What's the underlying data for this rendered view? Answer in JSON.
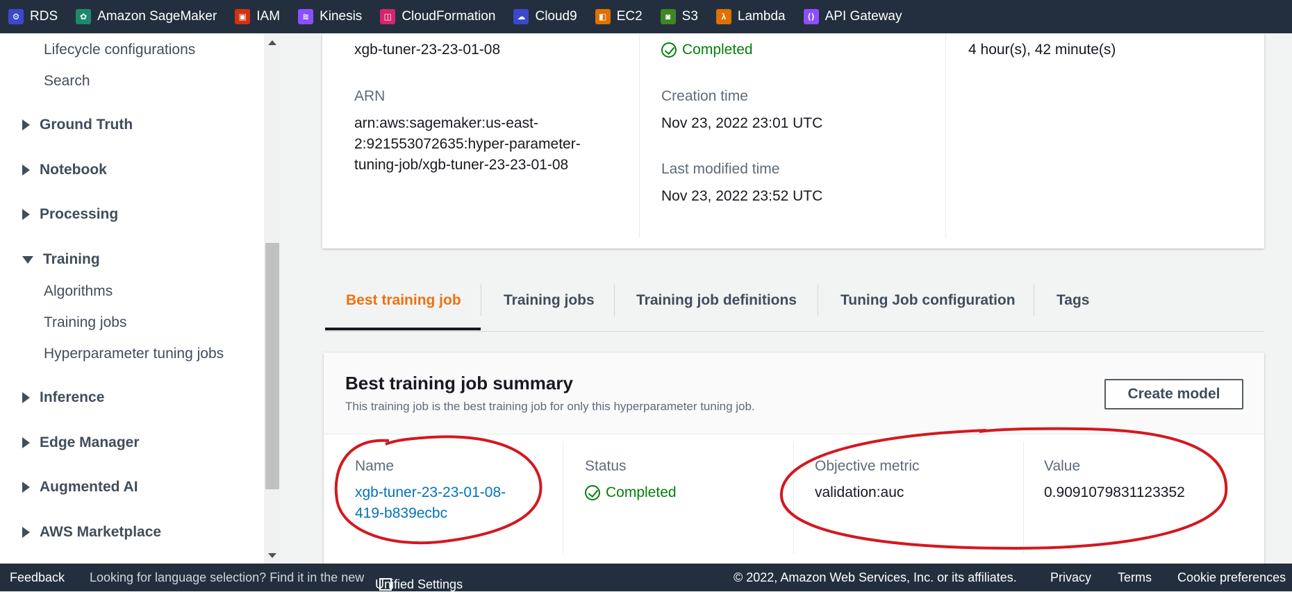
{
  "favorites": [
    {
      "label": "RDS",
      "icon": "rds-icon",
      "color": "#3b48cc"
    },
    {
      "label": "Amazon SageMaker",
      "icon": "sagemaker-icon",
      "color": "#1b8a6b"
    },
    {
      "label": "IAM",
      "icon": "iam-icon",
      "color": "#d13212"
    },
    {
      "label": "Kinesis",
      "icon": "kinesis-icon",
      "color": "#8c4fff"
    },
    {
      "label": "CloudFormation",
      "icon": "cloudformation-icon",
      "color": "#d6246e"
    },
    {
      "label": "Cloud9",
      "icon": "cloud9-icon",
      "color": "#3b48cc"
    },
    {
      "label": "EC2",
      "icon": "ec2-icon",
      "color": "#e07000"
    },
    {
      "label": "S3",
      "icon": "s3-icon",
      "color": "#3f8624"
    },
    {
      "label": "Lambda",
      "icon": "lambda-icon",
      "color": "#e07000"
    },
    {
      "label": "API Gateway",
      "icon": "api-gateway-icon",
      "color": "#8c4fff"
    }
  ],
  "sidebar": {
    "items": [
      {
        "label": "Lifecycle configurations"
      },
      {
        "label": "Search"
      },
      {
        "label": "Ground Truth"
      },
      {
        "label": "Notebook"
      },
      {
        "label": "Processing"
      },
      {
        "label": "Training"
      },
      {
        "label": "Algorithms"
      },
      {
        "label": "Training jobs"
      },
      {
        "label": "Hyperparameter tuning jobs"
      },
      {
        "label": "Inference"
      },
      {
        "label": "Edge Manager"
      },
      {
        "label": "Augmented AI"
      },
      {
        "label": "AWS Marketplace"
      }
    ]
  },
  "details": {
    "name_value": "xgb-tuner-23-23-01-08",
    "arn_label": "ARN",
    "arn_line1": "arn:aws:sagemaker:us-east-",
    "arn_line2": "2:921553072635:hyper-parameter-",
    "arn_line3": "tuning-job/xgb-tuner-23-23-01-08",
    "status_value": "Completed",
    "creation_label": "Creation time",
    "creation_value": "Nov 23, 2022 23:01 UTC",
    "modified_label": "Last modified time",
    "modified_value": "Nov 23, 2022 23:52 UTC",
    "duration_value": "4 hour(s), 42 minute(s)"
  },
  "tabs": [
    {
      "label": "Best training job"
    },
    {
      "label": "Training jobs"
    },
    {
      "label": "Training job definitions"
    },
    {
      "label": "Tuning Job configuration"
    },
    {
      "label": "Tags"
    }
  ],
  "summary": {
    "title": "Best training job summary",
    "description": "This training job is the best training job for only this hyperparameter tuning job.",
    "create_model_label": "Create model",
    "name_label": "Name",
    "name_line1": "xgb-tuner-23-23-01-08-",
    "name_line2": "419-b839ecbc",
    "status_label": "Status",
    "status_value": "Completed",
    "objective_label": "Objective metric",
    "objective_value": "validation:auc",
    "value_label": "Value",
    "value_value": "0.9091079831123352"
  },
  "footer": {
    "feedback": "Feedback",
    "language_text": "Looking for language selection? Find it in the new",
    "unified_settings": "Unified Settings",
    "copyright": "© 2022, Amazon Web Services, Inc. or its affiliates.",
    "privacy": "Privacy",
    "terms": "Terms",
    "cookies": "Cookie preferences"
  },
  "colors": {
    "accent_orange": "#ec7211",
    "success_green": "#037f0c",
    "link_blue": "#0073bb",
    "annotation_red": "#d4181f",
    "nav_dark": "#232f3e"
  }
}
